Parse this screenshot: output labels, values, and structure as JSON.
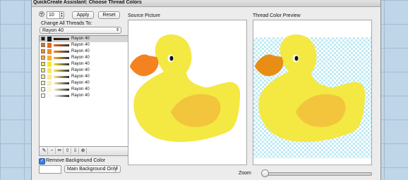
{
  "window": {
    "title": "QuickCreate Assistant: Choose Thread Colors"
  },
  "toolbar": {
    "count_value": "10",
    "apply_label": "Apply",
    "reset_label": "Reset"
  },
  "change_all": {
    "label": "Change All Threads To:",
    "selected": "Rayon 40"
  },
  "threads": [
    {
      "name": "Rayon 40",
      "color": "#1a1a1a"
    },
    {
      "name": "Rayon 40",
      "color": "#e26a1c"
    },
    {
      "name": "Rayon 40",
      "color": "#f08a25"
    },
    {
      "name": "Rayon 40",
      "color": "#f3b12f"
    },
    {
      "name": "Rayon 40",
      "color": "#f4e437"
    },
    {
      "name": "Rayon 40",
      "color": "#f2e665"
    },
    {
      "name": "Rayon 40",
      "color": "#f6ec8f"
    },
    {
      "name": "Rayon 40",
      "color": "#f8f0b4"
    },
    {
      "name": "Rayon 40",
      "color": "#fbf6d8"
    },
    {
      "name": "Rayon 40",
      "color": "#fbfbf5"
    }
  ],
  "list_tools": [
    "eyedropper-icon",
    "minus-icon",
    "pencil-icon",
    "arrow-up-icon",
    "arrow-down-icon",
    "target-icon",
    "delete-icon"
  ],
  "background": {
    "checkbox_label": "Remove Background Color",
    "checked": true,
    "mode": "Main Background Only"
  },
  "source": {
    "label": "Source Picture"
  },
  "preview": {
    "label": "Thread Color Preview"
  },
  "zoom": {
    "label": "Zoom",
    "level": 0.02
  },
  "duck": {
    "body": "#f4e842",
    "wing": "#f2c53d",
    "beak_source": "#f58220",
    "beak_preview": "#e88e16",
    "eye": "#111111"
  }
}
